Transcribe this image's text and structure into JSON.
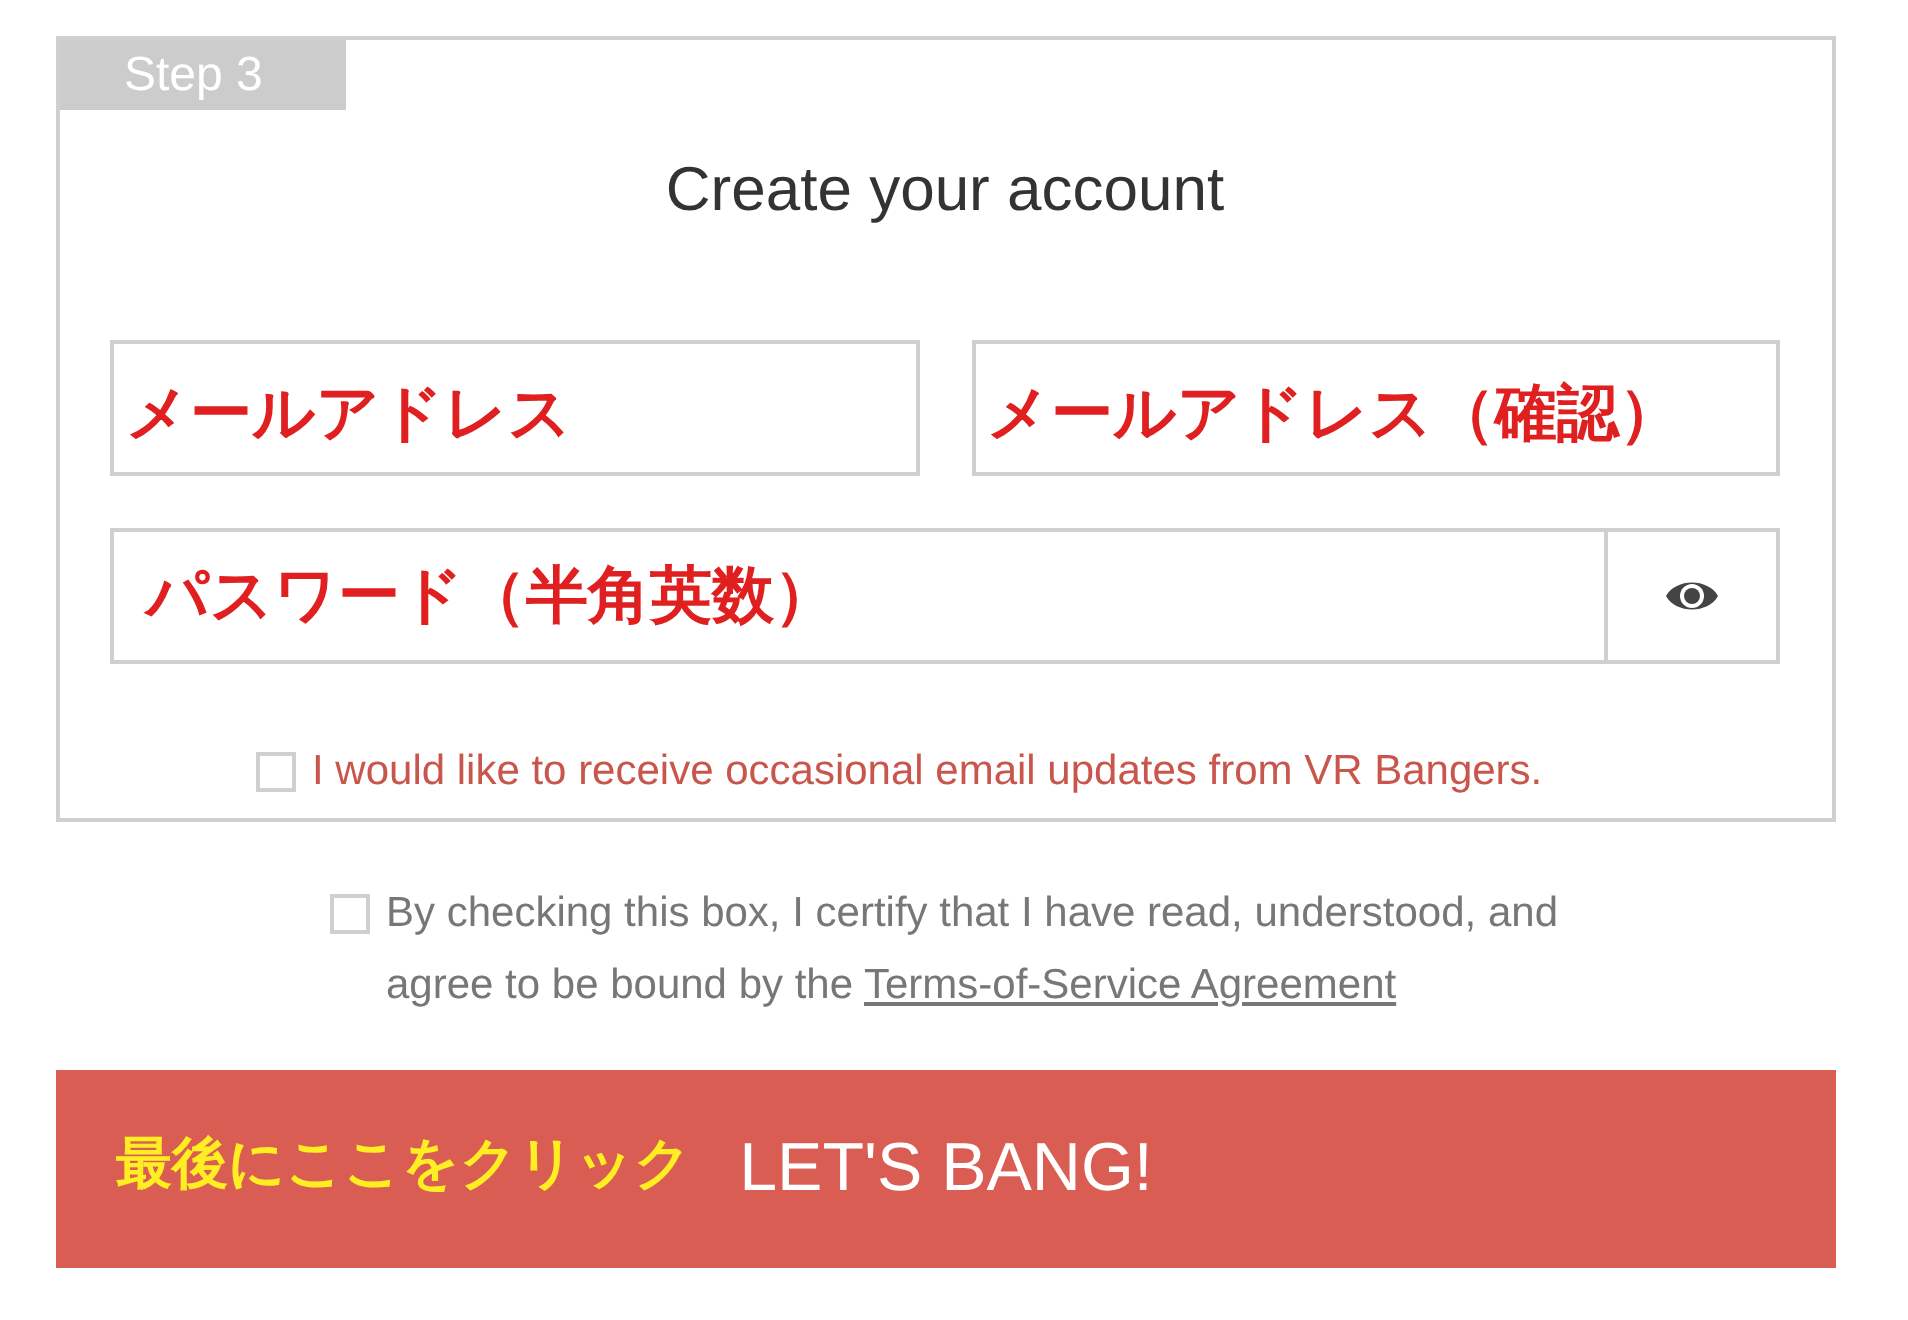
{
  "step_badge": "Step 3",
  "title": "Create your account",
  "fields": [
    {
      "value": "メールアドレス"
    },
    {
      "value": "メールアドレス（確認）"
    }
  ],
  "password": {
    "value": "パスワード（半角英数）"
  },
  "newsletter": {
    "label": "I would like to receive occasional email updates from VR Bangers.",
    "checked": false
  },
  "terms": {
    "text": "By checking this box, I certify that I have read, understood, and agree to be bound by the",
    "link": "Terms-of-Service Agreement",
    "checked": false
  },
  "submit": {
    "label": "LET'S BANG!",
    "annotation": "最後にここをクリック"
  }
}
